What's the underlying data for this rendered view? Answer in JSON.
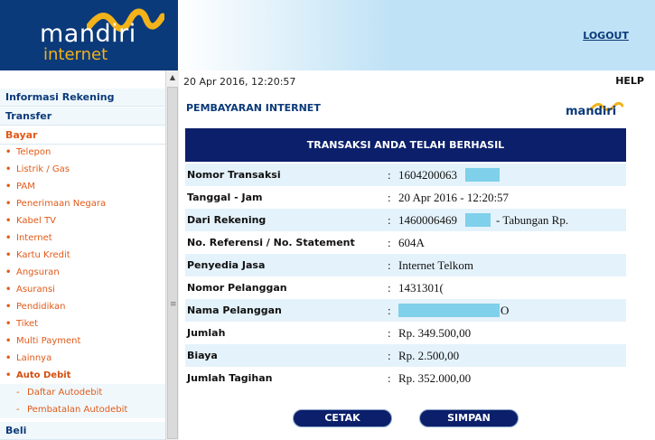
{
  "brand": {
    "logo_main": "mandiri",
    "logo_sub": "internet",
    "small_logo": "mandiri"
  },
  "header": {
    "logout": "LOGOUT",
    "help": "HELP",
    "datetime": "20 Apr 2016, 12:20:57"
  },
  "sidebar": {
    "informasi": "Informasi Rekening",
    "transfer": "Transfer",
    "bayar": "Bayar",
    "items": [
      "Telepon",
      "Listrik / Gas",
      "PAM",
      "Penerimaan Negara",
      "Kabel TV",
      "Internet",
      "Kartu Kredit",
      "Angsuran",
      "Asuransi",
      "Pendidikan",
      "Tiket",
      "Multi Payment",
      "Lainnya",
      "Auto Debit"
    ],
    "subitems": [
      "Daftar Autodebit",
      "Pembatalan Autodebit"
    ],
    "beli": "Beli"
  },
  "main": {
    "title": "PEMBAYARAN INTERNET",
    "success": "TRANSAKSI ANDA TELAH BERHASIL",
    "rows": [
      {
        "label": "Nomor Transaksi",
        "value": "1604200063"
      },
      {
        "label": "Tanggal - Jam",
        "value": "20 Apr 2016 - 12:20:57"
      },
      {
        "label": "Dari Rekening",
        "value": "1460006469",
        "suffix": "- Tabungan  Rp."
      },
      {
        "label": "No. Referensi / No. Statement",
        "value": "604A"
      },
      {
        "label": "Penyedia Jasa",
        "value": "Internet Telkom"
      },
      {
        "label": "Nomor Pelanggan",
        "value": "1431301("
      },
      {
        "label": "Nama Pelanggan",
        "value": "",
        "suffix": "O"
      },
      {
        "label": "Jumlah",
        "value": "Rp. 349.500,00"
      },
      {
        "label": "Biaya",
        "value": "Rp. 2.500,00"
      },
      {
        "label": "Jumlah Tagihan",
        "value": "Rp. 352.000,00"
      }
    ],
    "colon": ":",
    "buttons": {
      "cetak": "CETAK",
      "simpan": "SIMPAN"
    }
  },
  "colors": {
    "navy": "#0b1f6b",
    "brand_blue": "#0b3a7a",
    "gold": "#f2b21a",
    "orange": "#e15a19",
    "mask": "#7fd0ea"
  },
  "icons": {
    "scroll_up": "triangle-up-icon",
    "scroll_grip": "grip-lines-icon",
    "bullet": "bullet-dot-icon"
  }
}
